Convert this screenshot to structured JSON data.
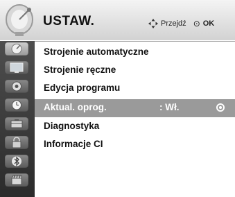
{
  "header": {
    "title": "USTAW.",
    "nav_hint": "Przejdź",
    "ok_hint": "OK",
    "icon": "satellite-dish-icon"
  },
  "sidebar": {
    "items": [
      {
        "icon": "satellite-icon",
        "active": true
      },
      {
        "icon": "tv-screen-icon",
        "active": false
      },
      {
        "icon": "speaker-icon",
        "active": false
      },
      {
        "icon": "clock-icon",
        "active": false
      },
      {
        "icon": "toolbox-icon",
        "active": false
      },
      {
        "icon": "lock-icon",
        "active": false
      },
      {
        "icon": "bluetooth-icon",
        "active": false
      },
      {
        "icon": "media-clapper-icon",
        "active": false
      }
    ]
  },
  "menu": {
    "items": [
      {
        "label": "Strojenie automatyczne"
      },
      {
        "label": "Strojenie ręczne"
      },
      {
        "label": "Edycja programu"
      },
      {
        "label": "Aktual. oprog.",
        "value": ": Wł.",
        "selected": true
      },
      {
        "label": "Diagnostyka"
      },
      {
        "label": "Informacje CI"
      }
    ]
  },
  "colors": {
    "selected_row": "#9a9a9a",
    "sidebar_bg": "#3a3a3a",
    "header_bg": "#e0e0e0"
  }
}
